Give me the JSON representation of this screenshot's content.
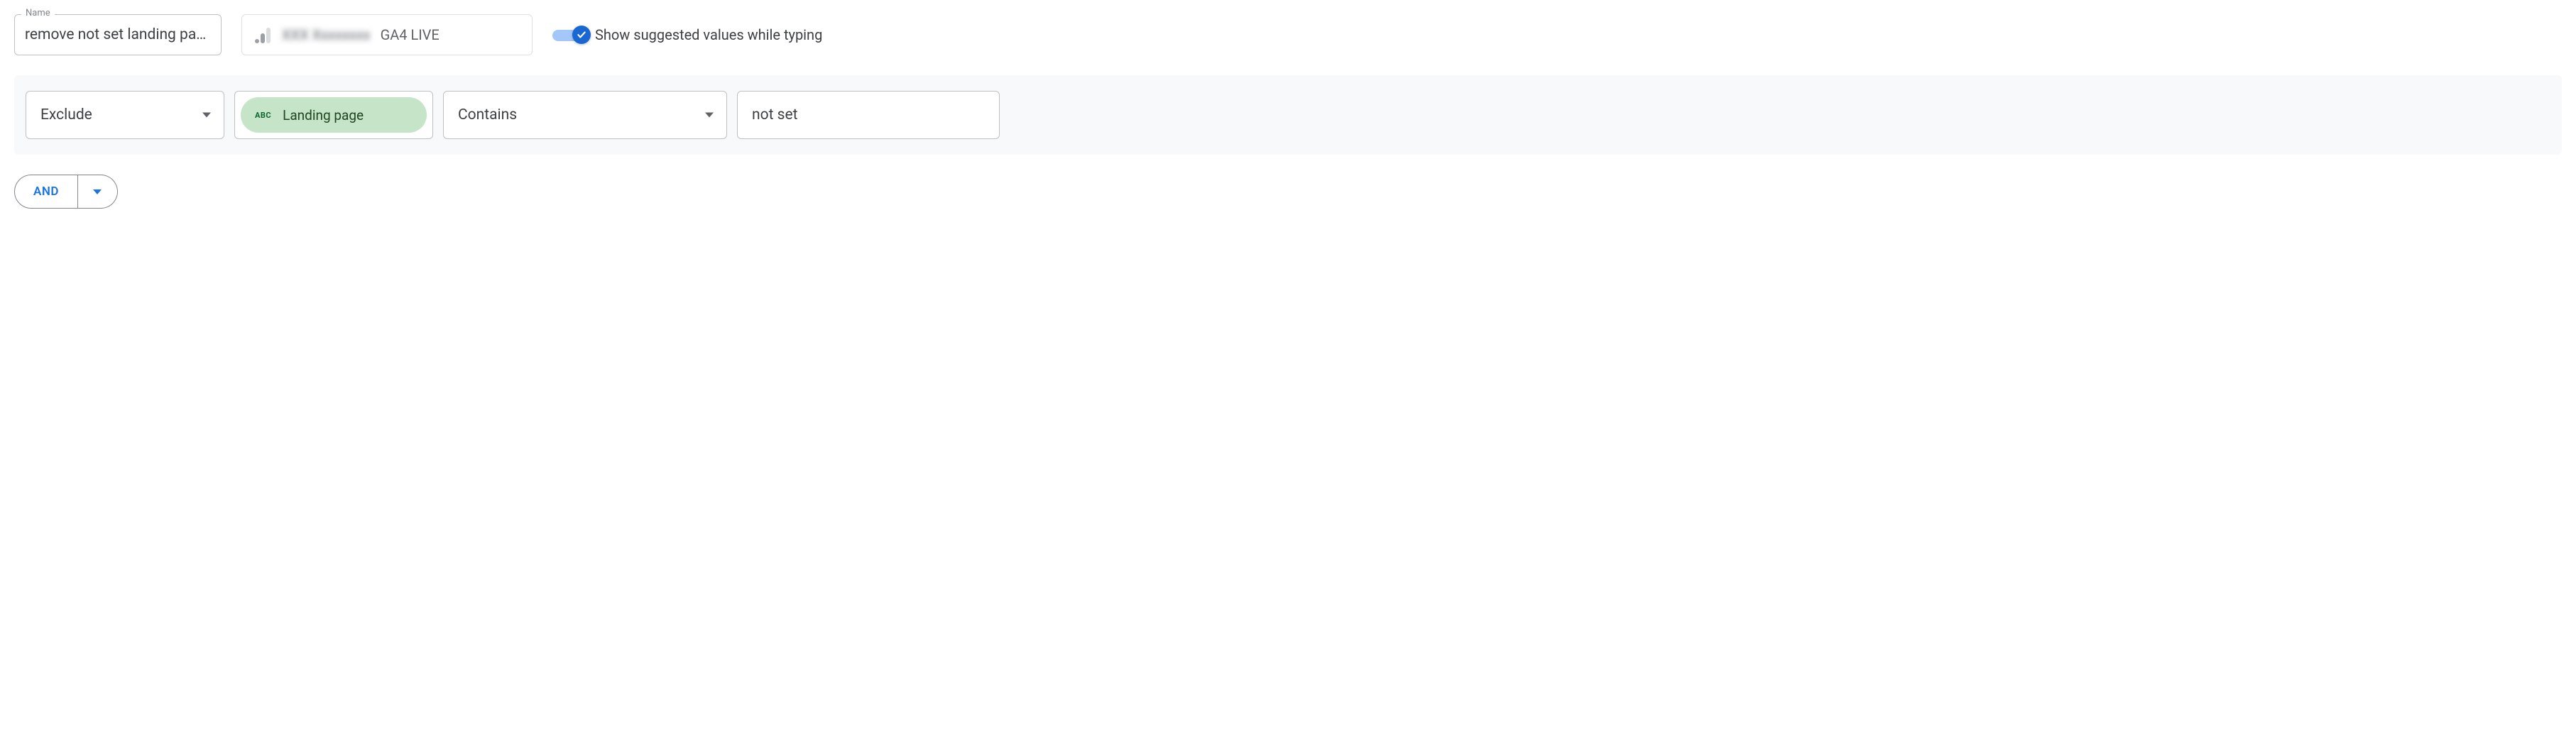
{
  "header": {
    "name_label": "Name",
    "name_value": "remove not set landing pages",
    "data_source_blurred": "XXX Xxxxxxxx",
    "data_source_suffix": "GA4 LIVE",
    "toggle_label": "Show suggested values while typing"
  },
  "filter": {
    "include_exclude": "Exclude",
    "dimension_badge": "ABC",
    "dimension": "Landing page",
    "operator": "Contains",
    "value": "not set"
  },
  "connector": {
    "and_label": "AND"
  }
}
